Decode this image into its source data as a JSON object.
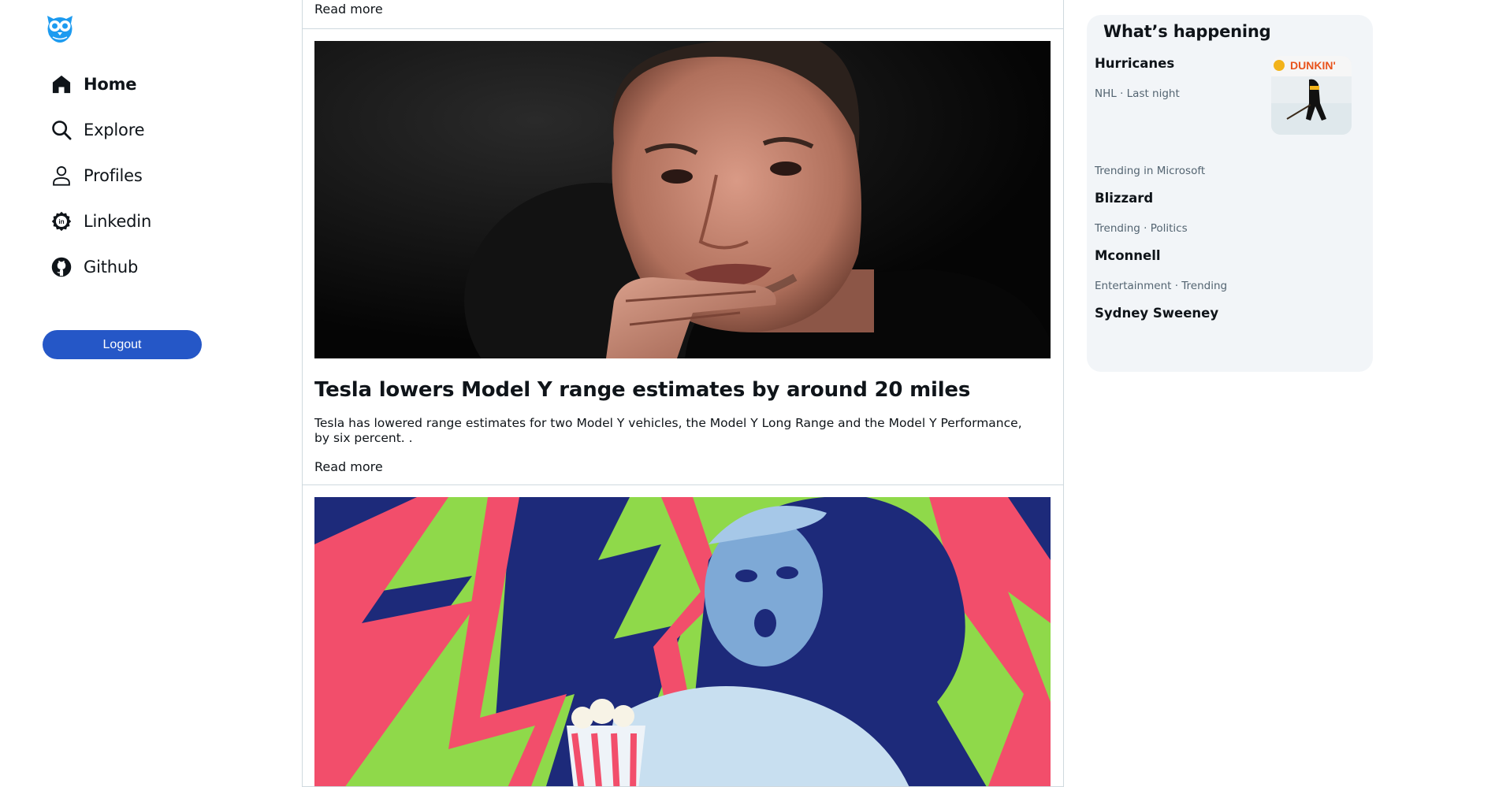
{
  "sidebar": {
    "logo_icon": "owl-logo-icon",
    "items": [
      {
        "label": "Home",
        "icon": "home-icon",
        "active": true
      },
      {
        "label": "Explore",
        "icon": "search-icon",
        "active": false
      },
      {
        "label": "Profiles",
        "icon": "person-icon",
        "active": false
      },
      {
        "label": "Linkedin",
        "icon": "linkedin-icon",
        "active": false
      },
      {
        "label": "Github",
        "icon": "github-icon",
        "active": false
      }
    ],
    "logout_label": "Logout"
  },
  "feed": {
    "previous_post": {
      "read_more": "Read more"
    },
    "posts": [
      {
        "image": "tesla-ceo-photo",
        "title": "Tesla lowers Model Y range estimates by around 20 miles",
        "excerpt": "Tesla has lowered range estimates for two Model Y vehicles, the Model Y Long Range and the Model Y Performance, by six percent. .",
        "read_more": "Read more"
      },
      {
        "image": "movie-popcorn-collage"
      }
    ]
  },
  "trends": {
    "title": "What’s happening",
    "items": [
      {
        "name": "Hurricanes",
        "meta": "NHL · Last night",
        "thumb_text": "DUNKIN'"
      },
      {
        "meta": "Trending in Microsoft",
        "name": "Blizzard"
      },
      {
        "meta": "Trending · Politics",
        "name": "Mconnell"
      },
      {
        "meta": "Entertainment · Trending",
        "name": "Sydney Sweeney"
      }
    ]
  },
  "colors": {
    "accent": "#2557c7",
    "logo": "#1d9bf0",
    "border": "#cfd9de",
    "panel_bg": "#f2f5f8",
    "muted_text": "#536471"
  }
}
